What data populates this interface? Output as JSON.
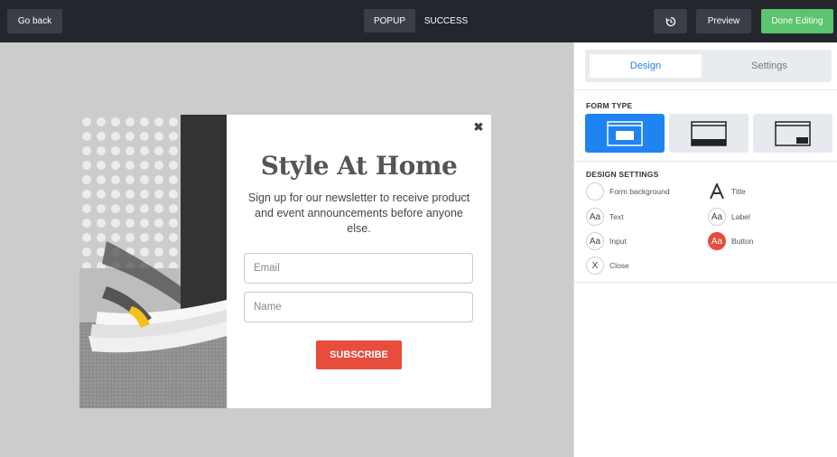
{
  "topbar": {
    "go_back": "Go back",
    "tabs": [
      {
        "label": "POPUP",
        "active": true
      },
      {
        "label": "SUCCESS",
        "active": false
      }
    ],
    "undo_icon": "history-icon",
    "preview": "Preview",
    "done": "Done Editing"
  },
  "popup": {
    "title": "Style At Home",
    "text": "Sign up for our newsletter to receive product and event announcements before anyone else.",
    "email_placeholder": "Email",
    "name_placeholder": "Name",
    "subscribe": "SUBSCRIBE",
    "close_icon": "close-icon"
  },
  "panel": {
    "tabs": [
      {
        "label": "Design",
        "active": true
      },
      {
        "label": "Settings",
        "active": false
      }
    ],
    "form_type_label": "FORM TYPE",
    "design_settings_label": "DESIGN SETTINGS",
    "design_settings": {
      "form_background": "Form background",
      "title": "Title",
      "text": "Text",
      "label": "Label",
      "input": "Input",
      "button": "Button",
      "close": "Close"
    },
    "icon_glyph_aa": "Aa",
    "icon_glyph_close": "X"
  },
  "colors": {
    "accent": "#1f84f2",
    "done": "#5cc36f",
    "subscribe": "#e84c3d",
    "topbar": "#23262d"
  }
}
